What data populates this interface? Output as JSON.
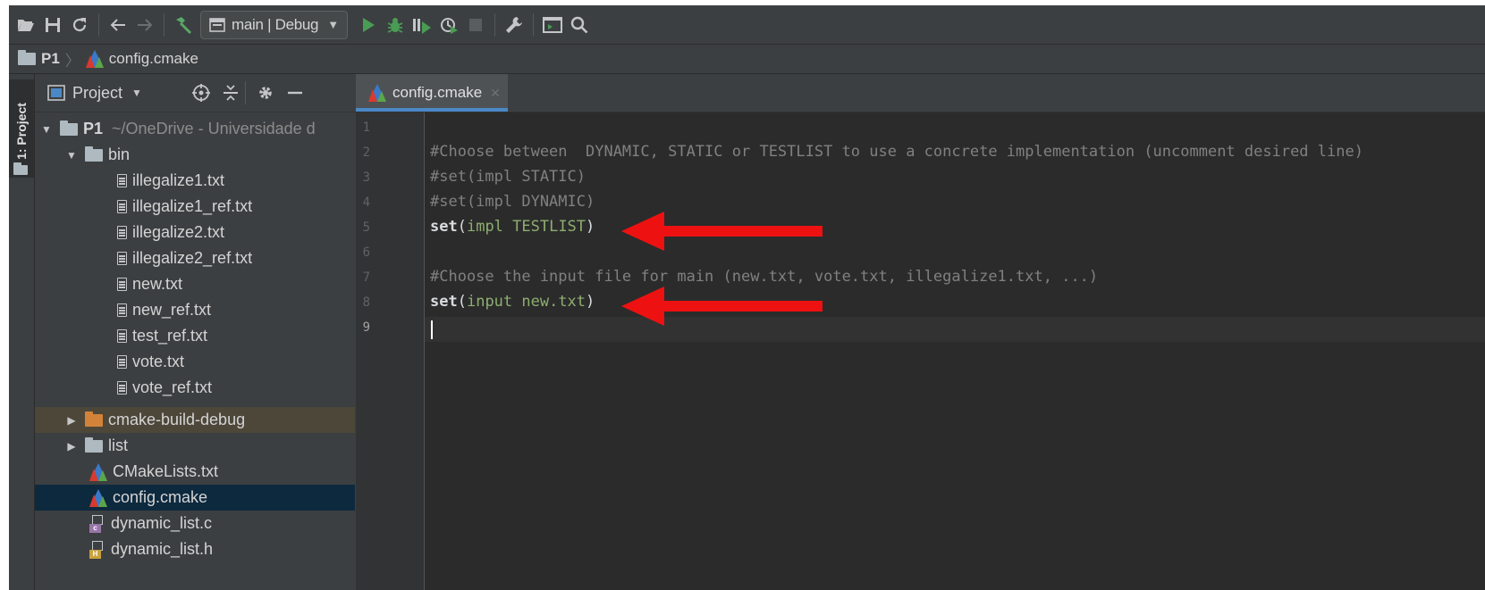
{
  "toolbar": {
    "run_config": "main | Debug",
    "icons": [
      "open-folder-icon",
      "save-icon",
      "sync-icon",
      "back-icon",
      "forward-icon",
      "build-hammer-icon",
      "run-icon",
      "debug-bug-icon",
      "run-coverage-icon",
      "profile-icon",
      "stop-icon",
      "settings-wrench-icon",
      "terminal-icon",
      "search-icon"
    ]
  },
  "breadcrumb": {
    "project": "P1",
    "file": "config.cmake"
  },
  "sidebar_strip": {
    "label": "1: Project"
  },
  "panel": {
    "title": "Project"
  },
  "tree": {
    "root_name": "P1",
    "root_path": "~/OneDrive - Universidade d",
    "items": [
      {
        "label": "bin"
      },
      {
        "label": "illegalize1.txt"
      },
      {
        "label": "illegalize1_ref.txt"
      },
      {
        "label": "illegalize2.txt"
      },
      {
        "label": "illegalize2_ref.txt"
      },
      {
        "label": "new.txt"
      },
      {
        "label": "new_ref.txt"
      },
      {
        "label": "test_ref.txt"
      },
      {
        "label": "vote.txt"
      },
      {
        "label": "vote_ref.txt"
      },
      {
        "label": "cmake-build-debug"
      },
      {
        "label": "list"
      },
      {
        "label": "CMakeLists.txt"
      },
      {
        "label": "config.cmake"
      },
      {
        "label": "dynamic_list.c"
      },
      {
        "label": "dynamic_list.h"
      }
    ]
  },
  "editor": {
    "tab_label": "config.cmake",
    "line_numbers": [
      "1",
      "2",
      "3",
      "4",
      "5",
      "6",
      "7",
      "8",
      "9"
    ],
    "lines": {
      "l2": "#Choose between  DYNAMIC, STATIC or TESTLIST to use a concrete implementation (uncomment desired line)",
      "l3": "#set(impl STATIC)",
      "l4": "#set(impl DYNAMIC)",
      "l5_kw": "set",
      "l5_open": "(",
      "l5_args": "impl TESTLIST",
      "l5_close": ")",
      "l7": "#Choose the input file for main (new.txt, vote.txt, illegalize1.txt, ...)",
      "l8_kw": "set",
      "l8_open": "(",
      "l8_args": "input new.txt",
      "l8_close": ")"
    }
  },
  "colors": {
    "annotation_arrow": "#ee1111",
    "selection": "#0d293e",
    "tab_underline": "#4a88c7"
  }
}
